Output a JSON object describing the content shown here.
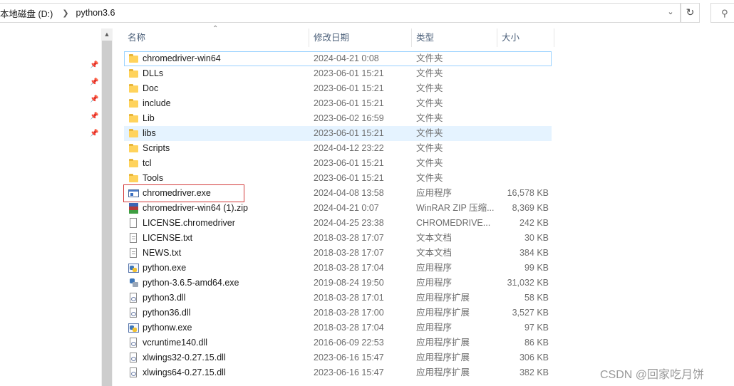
{
  "address": {
    "crumbs": [
      "本地磁盘 (D:)",
      "python3.6"
    ],
    "separator_icon": "chevron-right-icon"
  },
  "columns": {
    "name": "名称",
    "date": "修改日期",
    "type": "类型",
    "size": "大小"
  },
  "files": [
    {
      "name": "chromedriver-win64",
      "date": "2024-04-21 0:08",
      "type": "文件夹",
      "size": "",
      "icon": "folder-icon"
    },
    {
      "name": "DLLs",
      "date": "2023-06-01 15:21",
      "type": "文件夹",
      "size": "",
      "icon": "folder-icon"
    },
    {
      "name": "Doc",
      "date": "2023-06-01 15:21",
      "type": "文件夹",
      "size": "",
      "icon": "folder-icon"
    },
    {
      "name": "include",
      "date": "2023-06-01 15:21",
      "type": "文件夹",
      "size": "",
      "icon": "folder-icon"
    },
    {
      "name": "Lib",
      "date": "2023-06-02 16:59",
      "type": "文件夹",
      "size": "",
      "icon": "folder-icon"
    },
    {
      "name": "libs",
      "date": "2023-06-01 15:21",
      "type": "文件夹",
      "size": "",
      "icon": "folder-icon"
    },
    {
      "name": "Scripts",
      "date": "2024-04-12 23:22",
      "type": "文件夹",
      "size": "",
      "icon": "folder-icon"
    },
    {
      "name": "tcl",
      "date": "2023-06-01 15:21",
      "type": "文件夹",
      "size": "",
      "icon": "folder-icon"
    },
    {
      "name": "Tools",
      "date": "2023-06-01 15:21",
      "type": "文件夹",
      "size": "",
      "icon": "folder-icon"
    },
    {
      "name": "chromedriver.exe",
      "date": "2024-04-08 13:58",
      "type": "应用程序",
      "size": "16,578 KB",
      "icon": "exe-icon"
    },
    {
      "name": "chromedriver-win64 (1).zip",
      "date": "2024-04-21 0:07",
      "type": "WinRAR ZIP 压缩...",
      "size": "8,369 KB",
      "icon": "winrar-icon"
    },
    {
      "name": "LICENSE.chromedriver",
      "date": "2024-04-25 23:38",
      "type": "CHROMEDRIVE...",
      "size": "242 KB",
      "icon": "file-icon"
    },
    {
      "name": "LICENSE.txt",
      "date": "2018-03-28 17:07",
      "type": "文本文档",
      "size": "30 KB",
      "icon": "text-file-icon"
    },
    {
      "name": "NEWS.txt",
      "date": "2018-03-28 17:07",
      "type": "文本文档",
      "size": "384 KB",
      "icon": "text-file-icon"
    },
    {
      "name": "python.exe",
      "date": "2018-03-28 17:04",
      "type": "应用程序",
      "size": "99 KB",
      "icon": "python-icon"
    },
    {
      "name": "python-3.6.5-amd64.exe",
      "date": "2019-08-24 19:50",
      "type": "应用程序",
      "size": "31,032 KB",
      "icon": "installer-icon"
    },
    {
      "name": "python3.dll",
      "date": "2018-03-28 17:01",
      "type": "应用程序扩展",
      "size": "58 KB",
      "icon": "dll-icon"
    },
    {
      "name": "python36.dll",
      "date": "2018-03-28 17:00",
      "type": "应用程序扩展",
      "size": "3,527 KB",
      "icon": "dll-icon"
    },
    {
      "name": "pythonw.exe",
      "date": "2018-03-28 17:04",
      "type": "应用程序",
      "size": "97 KB",
      "icon": "python-icon"
    },
    {
      "name": "vcruntime140.dll",
      "date": "2016-06-09 22:53",
      "type": "应用程序扩展",
      "size": "86 KB",
      "icon": "dll-icon"
    },
    {
      "name": "xlwings32-0.27.15.dll",
      "date": "2023-06-16 15:47",
      "type": "应用程序扩展",
      "size": "306 KB",
      "icon": "dll-icon"
    },
    {
      "name": "xlwings64-0.27.15.dll",
      "date": "2023-06-16 15:47",
      "type": "应用程序扩展",
      "size": "382 KB",
      "icon": "dll-icon"
    }
  ],
  "focused_row": 0,
  "hover_row": 5,
  "highlighted_row": 9,
  "highlight_color": "#d33a3a",
  "watermark": "CSDN @回家吃月饼"
}
